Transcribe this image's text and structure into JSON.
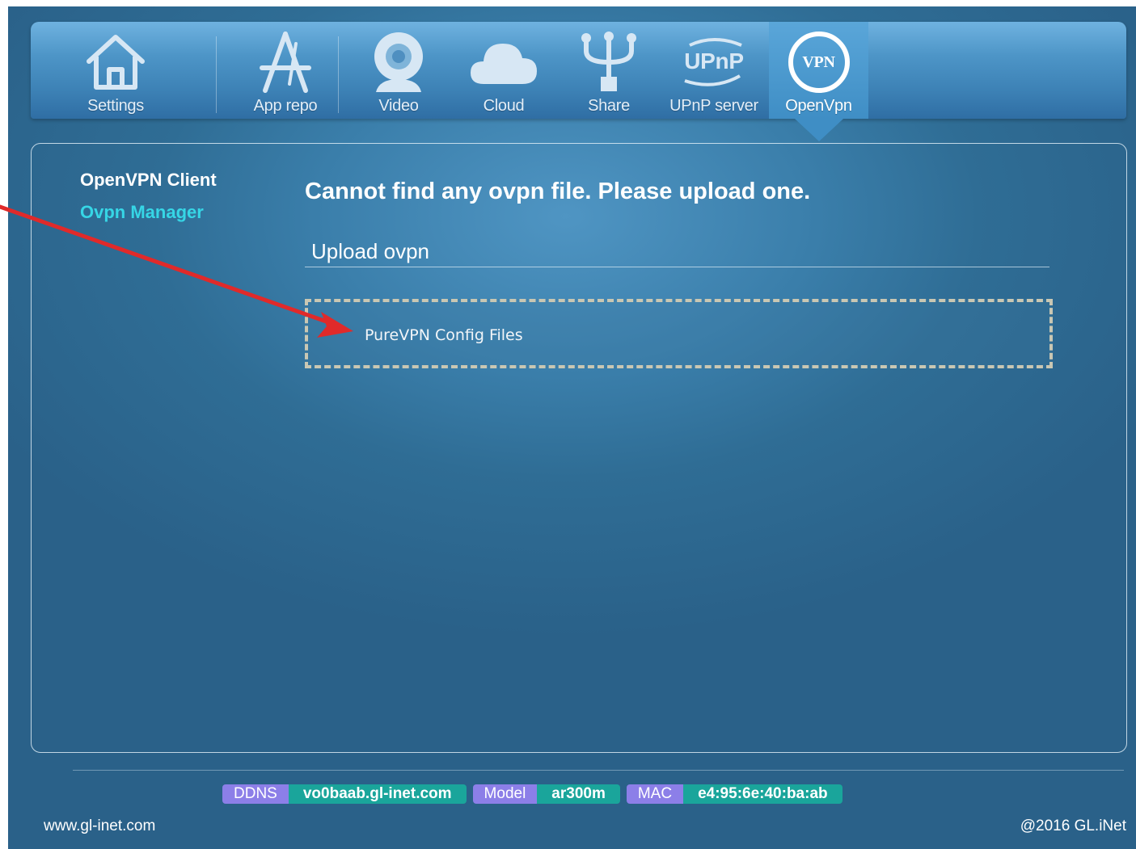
{
  "nav": {
    "items": [
      {
        "label": "Settings",
        "icon": "home-icon"
      },
      {
        "label": "App repo",
        "icon": "app-store-icon"
      },
      {
        "label": "Video",
        "icon": "webcam-icon"
      },
      {
        "label": "Cloud",
        "icon": "cloud-icon"
      },
      {
        "label": "Share",
        "icon": "usb-icon"
      },
      {
        "label": "UPnP server",
        "icon": "upnp-icon",
        "icon_text": "UPnP"
      },
      {
        "label": "OpenVpn",
        "icon": "vpn-icon",
        "icon_text": "VPN",
        "active": true
      }
    ]
  },
  "sidebar": {
    "items": [
      {
        "label": "OpenVPN Client",
        "active": false
      },
      {
        "label": "Ovpn Manager",
        "active": true
      }
    ]
  },
  "main": {
    "title": "Cannot find any ovpn file. Please upload one.",
    "section_title": "Upload ovpn",
    "drop_zone_item": "PureVPN Config Files"
  },
  "footer": {
    "info": [
      {
        "key": "DDNS",
        "value": "vo0baab.gl-inet.com"
      },
      {
        "key": "Model",
        "value": "ar300m"
      },
      {
        "key": "MAC",
        "value": "e4:95:6e:40:ba:ab"
      }
    ],
    "left_text": "www.gl-inet.com",
    "right_text": "@2016 GL.iNet"
  },
  "colors": {
    "accent_active": "#36d6e6",
    "info_key_bg": "#8c7fe8",
    "info_val_bg": "#1aa59b",
    "annotation_arrow": "#e02a2a"
  }
}
